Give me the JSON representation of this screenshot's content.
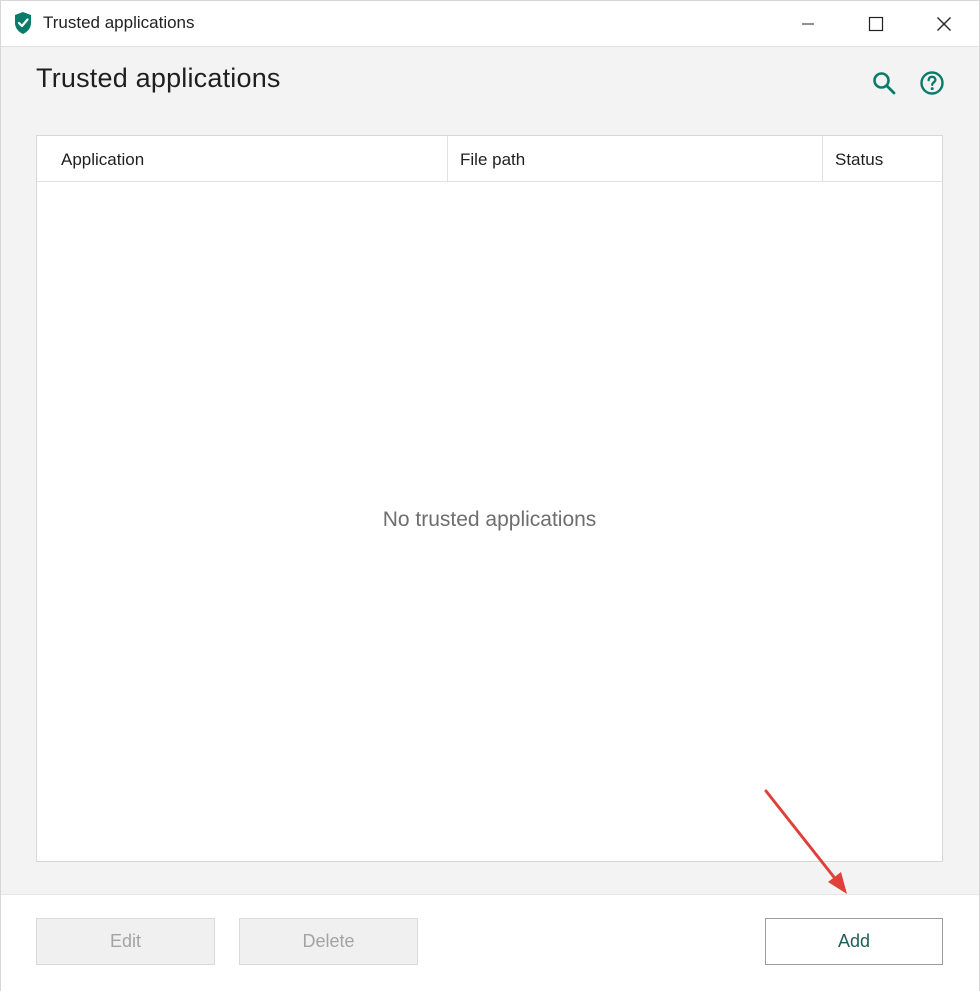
{
  "window": {
    "title": "Trusted applications",
    "controls": [
      "minimize",
      "maximize",
      "close"
    ]
  },
  "header": {
    "title": "Trusted applications",
    "icons": [
      "search-icon",
      "help-icon"
    ]
  },
  "table": {
    "columns": [
      "Application",
      "File path",
      "Status"
    ],
    "rows": [],
    "empty_message": "No trusted applications"
  },
  "footer": {
    "edit_label": "Edit",
    "delete_label": "Delete",
    "add_label": "Add"
  },
  "colors": {
    "accent": "#0a7a69",
    "add_text": "#1f5e57",
    "annotation_arrow": "#e0403a"
  }
}
